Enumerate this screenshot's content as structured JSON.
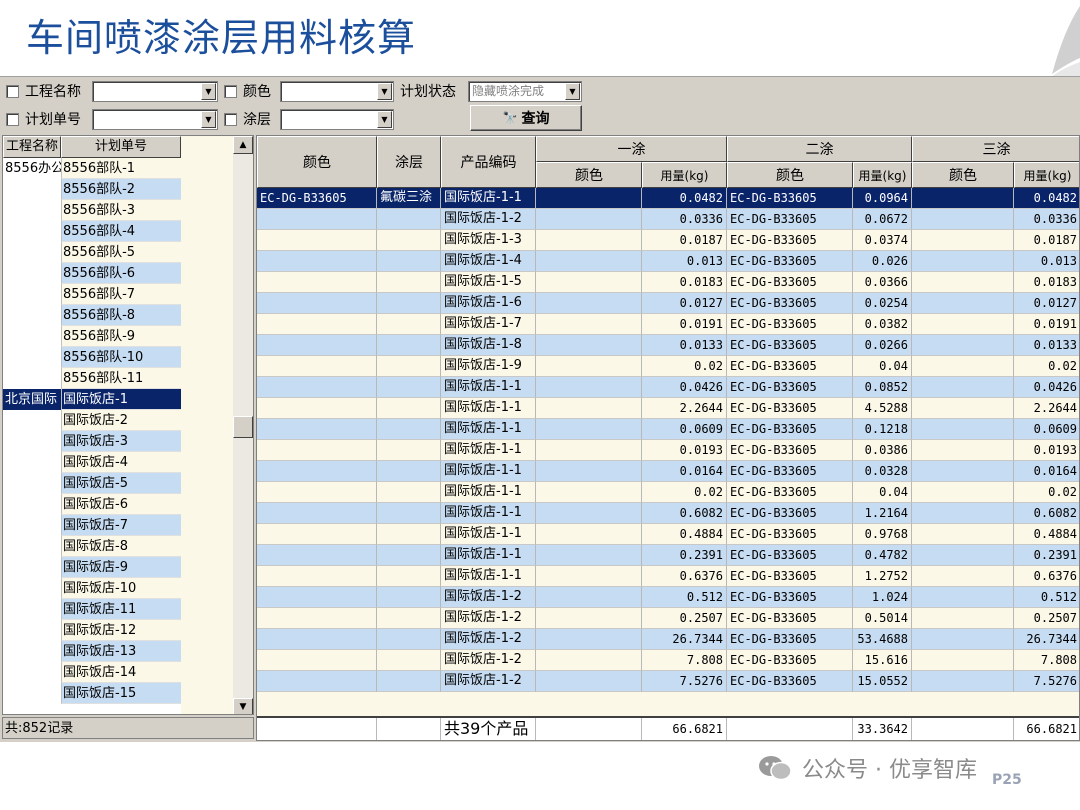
{
  "slide": {
    "title": "车间喷漆涂层用料核算",
    "page": "P25"
  },
  "filters": {
    "project_label": "工程名称",
    "color_label": "颜色",
    "status_label": "计划状态",
    "status_value": "隐藏喷涂完成",
    "plan_label": "计划单号",
    "coat_label": "涂层",
    "query_label": "查询"
  },
  "left_list": {
    "headers": [
      "工程名称",
      "计划单号"
    ],
    "rows": [
      [
        "8556办公",
        "8556部队-1"
      ],
      [
        "",
        "8556部队-2"
      ],
      [
        "",
        "8556部队-3"
      ],
      [
        "",
        "8556部队-4"
      ],
      [
        "",
        "8556部队-5"
      ],
      [
        "",
        "8556部队-6"
      ],
      [
        "",
        "8556部队-7"
      ],
      [
        "",
        "8556部队-8"
      ],
      [
        "",
        "8556部队-9"
      ],
      [
        "",
        "8556部队-10"
      ],
      [
        "",
        "8556部队-11"
      ],
      [
        "北京国际",
        "国际饭店-1"
      ],
      [
        "",
        "国际饭店-2"
      ],
      [
        "",
        "国际饭店-3"
      ],
      [
        "",
        "国际饭店-4"
      ],
      [
        "",
        "国际饭店-5"
      ],
      [
        "",
        "国际饭店-6"
      ],
      [
        "",
        "国际饭店-7"
      ],
      [
        "",
        "国际饭店-8"
      ],
      [
        "",
        "国际饭店-9"
      ],
      [
        "",
        "国际饭店-10"
      ],
      [
        "",
        "国际饭店-11"
      ],
      [
        "",
        "国际饭店-12"
      ],
      [
        "",
        "国际饭店-13"
      ],
      [
        "",
        "国际饭店-14"
      ],
      [
        "",
        "国际饭店-15"
      ]
    ],
    "selected_index": 11,
    "status": "共:852记录"
  },
  "grid": {
    "headers": {
      "color": "颜色",
      "coat": "涂层",
      "product_code": "产品编码",
      "coat1": "一涂",
      "coat2": "二涂",
      "coat3": "三涂",
      "sub_color": "颜色",
      "sub_amount": "用量(kg)"
    },
    "rows": [
      [
        "EC-DG-B33605",
        "氟碳三涂",
        "国际饭店-1-1",
        "",
        "0.0482",
        "EC-DG-B33605",
        "0.0964",
        "",
        "0.0482"
      ],
      [
        "",
        "",
        "国际饭店-1-2",
        "",
        "0.0336",
        "EC-DG-B33605",
        "0.0672",
        "",
        "0.0336"
      ],
      [
        "",
        "",
        "国际饭店-1-3",
        "",
        "0.0187",
        "EC-DG-B33605",
        "0.0374",
        "",
        "0.0187"
      ],
      [
        "",
        "",
        "国际饭店-1-4",
        "",
        "0.013",
        "EC-DG-B33605",
        "0.026",
        "",
        "0.013"
      ],
      [
        "",
        "",
        "国际饭店-1-5",
        "",
        "0.0183",
        "EC-DG-B33605",
        "0.0366",
        "",
        "0.0183"
      ],
      [
        "",
        "",
        "国际饭店-1-6",
        "",
        "0.0127",
        "EC-DG-B33605",
        "0.0254",
        "",
        "0.0127"
      ],
      [
        "",
        "",
        "国际饭店-1-7",
        "",
        "0.0191",
        "EC-DG-B33605",
        "0.0382",
        "",
        "0.0191"
      ],
      [
        "",
        "",
        "国际饭店-1-8",
        "",
        "0.0133",
        "EC-DG-B33605",
        "0.0266",
        "",
        "0.0133"
      ],
      [
        "",
        "",
        "国际饭店-1-9",
        "",
        "0.02",
        "EC-DG-B33605",
        "0.04",
        "",
        "0.02"
      ],
      [
        "",
        "",
        "国际饭店-1-1",
        "",
        "0.0426",
        "EC-DG-B33605",
        "0.0852",
        "",
        "0.0426"
      ],
      [
        "",
        "",
        "国际饭店-1-1",
        "",
        "2.2644",
        "EC-DG-B33605",
        "4.5288",
        "",
        "2.2644"
      ],
      [
        "",
        "",
        "国际饭店-1-1",
        "",
        "0.0609",
        "EC-DG-B33605",
        "0.1218",
        "",
        "0.0609"
      ],
      [
        "",
        "",
        "国际饭店-1-1",
        "",
        "0.0193",
        "EC-DG-B33605",
        "0.0386",
        "",
        "0.0193"
      ],
      [
        "",
        "",
        "国际饭店-1-1",
        "",
        "0.0164",
        "EC-DG-B33605",
        "0.0328",
        "",
        "0.0164"
      ],
      [
        "",
        "",
        "国际饭店-1-1",
        "",
        "0.02",
        "EC-DG-B33605",
        "0.04",
        "",
        "0.02"
      ],
      [
        "",
        "",
        "国际饭店-1-1",
        "",
        "0.6082",
        "EC-DG-B33605",
        "1.2164",
        "",
        "0.6082"
      ],
      [
        "",
        "",
        "国际饭店-1-1",
        "",
        "0.4884",
        "EC-DG-B33605",
        "0.9768",
        "",
        "0.4884"
      ],
      [
        "",
        "",
        "国际饭店-1-1",
        "",
        "0.2391",
        "EC-DG-B33605",
        "0.4782",
        "",
        "0.2391"
      ],
      [
        "",
        "",
        "国际饭店-1-1",
        "",
        "0.6376",
        "EC-DG-B33605",
        "1.2752",
        "",
        "0.6376"
      ],
      [
        "",
        "",
        "国际饭店-1-2",
        "",
        "0.512",
        "EC-DG-B33605",
        "1.024",
        "",
        "0.512"
      ],
      [
        "",
        "",
        "国际饭店-1-2",
        "",
        "0.2507",
        "EC-DG-B33605",
        "0.5014",
        "",
        "0.2507"
      ],
      [
        "",
        "",
        "国际饭店-1-2",
        "",
        "26.7344",
        "EC-DG-B33605",
        "53.4688",
        "",
        "26.7344"
      ],
      [
        "",
        "",
        "国际饭店-1-2",
        "",
        "7.808",
        "EC-DG-B33605",
        "15.616",
        "",
        "7.808"
      ],
      [
        "",
        "",
        "国际饭店-1-2",
        "",
        "7.5276",
        "EC-DG-B33605",
        "15.0552",
        "",
        "7.5276"
      ]
    ],
    "selected_index": 0,
    "footer": [
      "",
      "",
      "共39个产品",
      "",
      "66.6821",
      "",
      "33.3642",
      "",
      "66.6821"
    ]
  },
  "watermark": {
    "text": "公众号 · 优享智库"
  }
}
